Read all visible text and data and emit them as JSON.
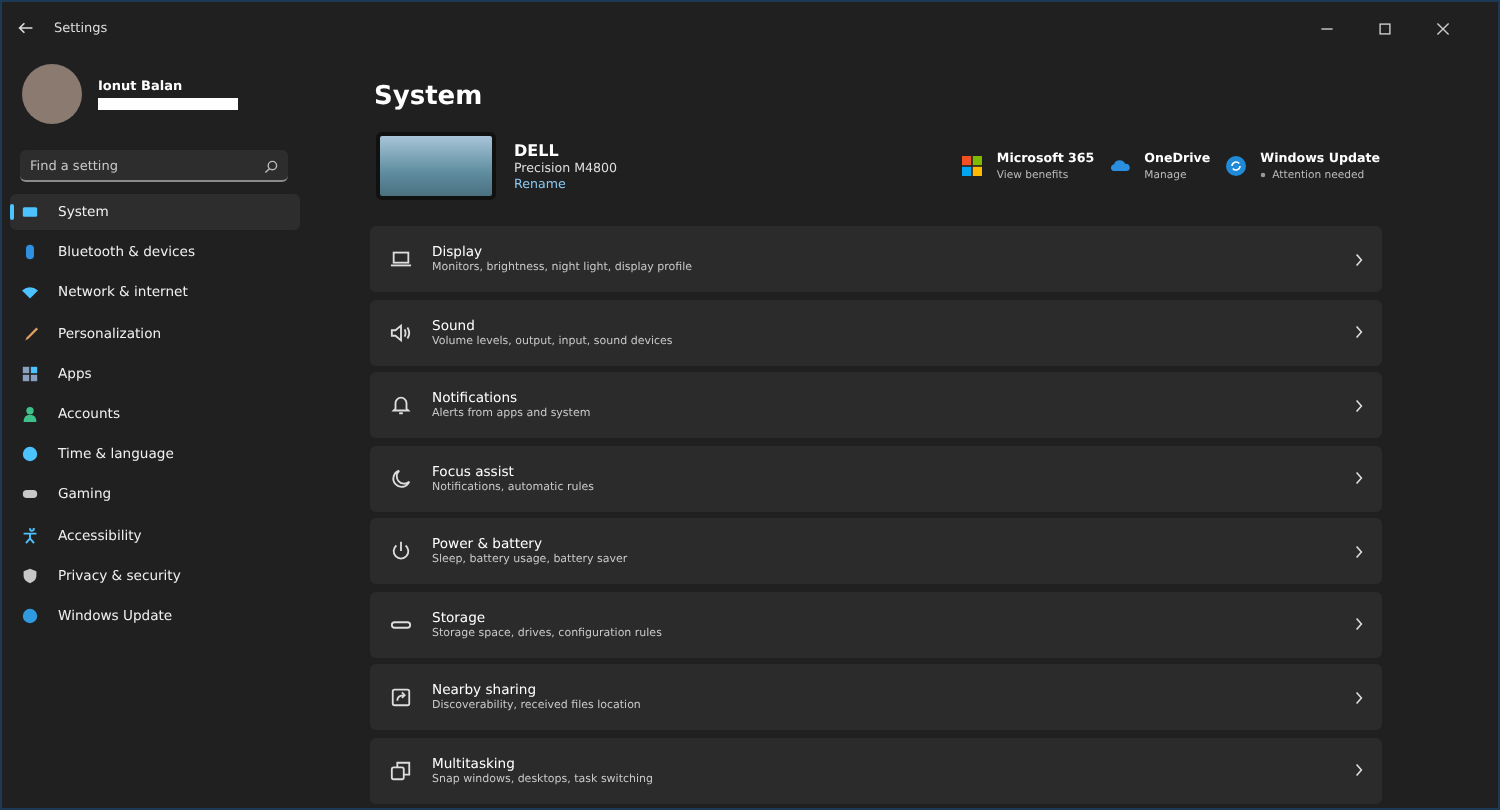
{
  "window": {
    "title": "Settings"
  },
  "account": {
    "name": "Ionut Balan"
  },
  "search": {
    "placeholder": "Find a setting"
  },
  "sidebar": {
    "items": [
      {
        "label": "System",
        "selected": true
      },
      {
        "label": "Bluetooth & devices",
        "selected": false
      },
      {
        "label": "Network & internet",
        "selected": false
      },
      {
        "label": "Personalization",
        "selected": false
      },
      {
        "label": "Apps",
        "selected": false
      },
      {
        "label": "Accounts",
        "selected": false
      },
      {
        "label": "Time & language",
        "selected": false
      },
      {
        "label": "Gaming",
        "selected": false
      },
      {
        "label": "Accessibility",
        "selected": false
      },
      {
        "label": "Privacy & security",
        "selected": false
      },
      {
        "label": "Windows Update",
        "selected": false
      }
    ]
  },
  "page": {
    "title": "System"
  },
  "device": {
    "name": "DELL",
    "model": "Precision M4800",
    "rename": "Rename"
  },
  "quick_links": [
    {
      "title": "Microsoft 365",
      "subtitle": "View benefits"
    },
    {
      "title": "OneDrive",
      "subtitle": "Manage"
    },
    {
      "title": "Windows Update",
      "subtitle": "Attention needed"
    }
  ],
  "settings": [
    {
      "title": "Display",
      "subtitle": "Monitors, brightness, night light, display profile"
    },
    {
      "title": "Sound",
      "subtitle": "Volume levels, output, input, sound devices"
    },
    {
      "title": "Notifications",
      "subtitle": "Alerts from apps and system"
    },
    {
      "title": "Focus assist",
      "subtitle": "Notifications, automatic rules"
    },
    {
      "title": "Power & battery",
      "subtitle": "Sleep, battery usage, battery saver"
    },
    {
      "title": "Storage",
      "subtitle": "Storage space, drives, configuration rules"
    },
    {
      "title": "Nearby sharing",
      "subtitle": "Discoverability, received files location"
    },
    {
      "title": "Multitasking",
      "subtitle": "Snap windows, desktops, task switching"
    }
  ]
}
